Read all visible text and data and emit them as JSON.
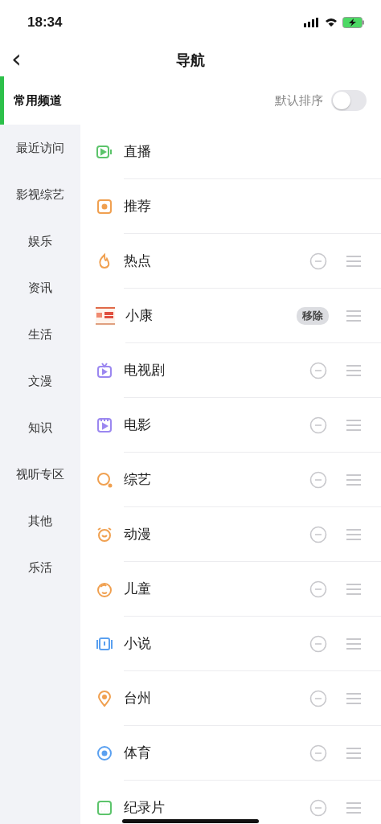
{
  "status_bar": {
    "time": "18:34"
  },
  "header": {
    "title": "导航",
    "back": "‹"
  },
  "sort_toggle": {
    "label": "默认排序",
    "on": false
  },
  "sidebar": {
    "items": [
      {
        "label": "常用频道",
        "selected": true
      },
      {
        "label": "最近访问",
        "selected": false
      },
      {
        "label": "影视综艺",
        "selected": false
      },
      {
        "label": "娱乐",
        "selected": false
      },
      {
        "label": "资讯",
        "selected": false
      },
      {
        "label": "生活",
        "selected": false
      },
      {
        "label": "文漫",
        "selected": false
      },
      {
        "label": "知识",
        "selected": false
      },
      {
        "label": "视听专区",
        "selected": false
      },
      {
        "label": "其他",
        "selected": false
      },
      {
        "label": "乐活",
        "selected": false
      }
    ]
  },
  "channels": [
    {
      "name": "直播",
      "kind": "fixed",
      "color": "#5cc46b"
    },
    {
      "name": "推荐",
      "kind": "fixed",
      "color": "#f0a050"
    },
    {
      "name": "热点",
      "kind": "removable",
      "color": "#f0a050"
    },
    {
      "name": "小康",
      "kind": "removing",
      "action": "移除"
    },
    {
      "name": "电视剧",
      "kind": "removable",
      "color": "#9b87f0"
    },
    {
      "name": "电影",
      "kind": "removable",
      "color": "#9b87f0"
    },
    {
      "name": "综艺",
      "kind": "removable",
      "color": "#f0a050"
    },
    {
      "name": "动漫",
      "kind": "removable",
      "color": "#f0a050"
    },
    {
      "name": "儿童",
      "kind": "removable",
      "color": "#f0a050"
    },
    {
      "name": "小说",
      "kind": "removable",
      "color": "#5aa0f0"
    },
    {
      "name": "台州",
      "kind": "removable",
      "color": "#f0a050"
    },
    {
      "name": "体育",
      "kind": "removable",
      "color": "#5aa0f0"
    },
    {
      "name": "纪录片",
      "kind": "removable",
      "color": "#5cc46b"
    }
  ]
}
